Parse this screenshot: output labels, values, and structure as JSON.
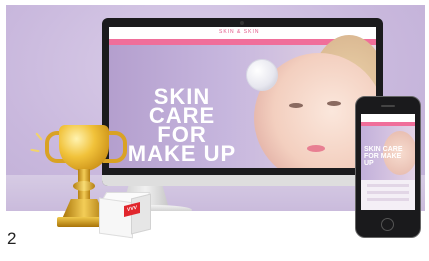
{
  "slide_number": "2",
  "monitor_site": {
    "logo": "SKIN & SKIN",
    "nav_items": [
      "",
      "",
      "",
      "",
      "",
      ""
    ],
    "hero_title": "SKIN CARE FOR MAKE UP",
    "hero_subtitle": "",
    "hero_subtitle_line2": "",
    "hero_subtitle_line3": ""
  },
  "phone_site": {
    "logo": "",
    "hero_title": "SKIN CARE FOR MAKE UP"
  },
  "box_logo": "VVV",
  "colors": {
    "background": "#c9b8dd",
    "accent": "#f06e9a",
    "trophy_gold": "#f1c23a"
  }
}
